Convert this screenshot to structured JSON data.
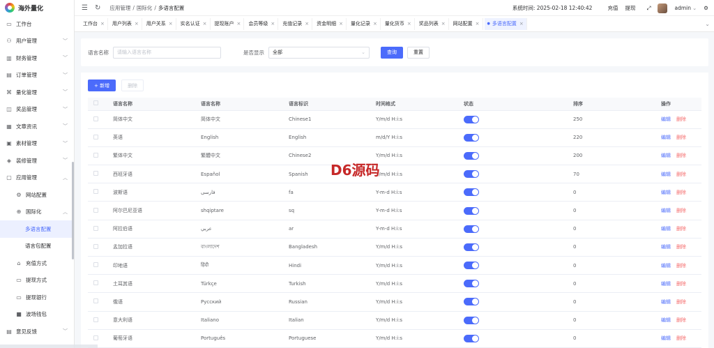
{
  "app": {
    "title": "海外量化"
  },
  "sidebar": {
    "items": [
      {
        "label": "工作台",
        "icon": "monitor-icon",
        "glyph": "▭",
        "chevron": false,
        "level": 0
      },
      {
        "label": "用户管理",
        "icon": "user-icon",
        "glyph": "⚇",
        "chevron": true,
        "level": 0
      },
      {
        "label": "财务管理",
        "icon": "finance-icon",
        "glyph": "▥",
        "chevron": true,
        "level": 0
      },
      {
        "label": "订单管理",
        "icon": "order-icon",
        "glyph": "▤",
        "chevron": true,
        "level": 0
      },
      {
        "label": "量化管理",
        "icon": "quant-icon",
        "glyph": "⌘",
        "chevron": true,
        "level": 0
      },
      {
        "label": "奖品管理",
        "icon": "gift-icon",
        "glyph": "◫",
        "chevron": true,
        "level": 0
      },
      {
        "label": "文章资讯",
        "icon": "article-icon",
        "glyph": "▦",
        "chevron": true,
        "level": 0
      },
      {
        "label": "素材管理",
        "icon": "image-icon",
        "glyph": "▣",
        "chevron": true,
        "level": 0
      },
      {
        "label": "装修管理",
        "icon": "decorate-icon",
        "glyph": "◈",
        "chevron": true,
        "level": 0
      },
      {
        "label": "应用管理",
        "icon": "app-icon",
        "glyph": "▢",
        "chevron": true,
        "level": 0
      },
      {
        "label": "网站配置",
        "icon": "gear-icon",
        "glyph": "⚙",
        "chevron": false,
        "level": 1
      },
      {
        "label": "国际化",
        "icon": "globe-icon",
        "glyph": "⊕",
        "chevron": true,
        "level": 1
      },
      {
        "label": "多语言配置",
        "icon": "",
        "glyph": "",
        "chevron": false,
        "level": 2,
        "active": true
      },
      {
        "label": "语言包配置",
        "icon": "",
        "glyph": "",
        "chevron": false,
        "level": 2
      },
      {
        "label": "充值方式",
        "icon": "recharge-icon",
        "glyph": "⌂",
        "chevron": false,
        "level": 1
      },
      {
        "label": "提现方式",
        "icon": "folder-icon",
        "glyph": "▭",
        "chevron": false,
        "level": 1
      },
      {
        "label": "提现银行",
        "icon": "bank-icon",
        "glyph": "▭",
        "chevron": false,
        "level": 1
      },
      {
        "label": "波场钱包",
        "icon": "wallet-icon",
        "glyph": "■",
        "chevron": false,
        "level": 1
      },
      {
        "label": "意见反馈",
        "icon": "feedback-icon",
        "glyph": "▤",
        "chevron": true,
        "level": 0
      }
    ]
  },
  "header": {
    "breadcrumb": [
      "应用管理",
      "国际化",
      "多语言配置"
    ],
    "system_time_label": "系统时间: 2025-02-18 12:40:42",
    "recharge": "充值",
    "withdraw": "提现",
    "user": "admin"
  },
  "tabs": [
    {
      "label": "工作台",
      "active": false
    },
    {
      "label": "用户列表",
      "active": false
    },
    {
      "label": "用户关系",
      "active": false
    },
    {
      "label": "实名认证",
      "active": false
    },
    {
      "label": "提现账户",
      "active": false
    },
    {
      "label": "会员等级",
      "active": false
    },
    {
      "label": "充值记录",
      "active": false
    },
    {
      "label": "资金明细",
      "active": false
    },
    {
      "label": "量化记录",
      "active": false
    },
    {
      "label": "量化货币",
      "active": false
    },
    {
      "label": "奖品列表",
      "active": false
    },
    {
      "label": "网站配置",
      "active": false
    },
    {
      "label": "多语言配置",
      "active": true
    }
  ],
  "filter": {
    "name_label": "语言名称",
    "name_placeholder": "请输入语言名称",
    "show_label": "是否显示",
    "show_value": "全部",
    "search": "查询",
    "reset": "重置"
  },
  "toolbar": {
    "add": "+ 新增",
    "delete": "删除"
  },
  "table": {
    "headers": [
      "语言名称",
      "语言名称",
      "语言标识",
      "时间格式",
      "状态",
      "排序",
      "操作"
    ],
    "edit": "编辑",
    "delete": "删除",
    "rows": [
      [
        "简体中文",
        "简体中文",
        "Chinese1",
        "Y/m/d H:i:s",
        "250"
      ],
      [
        "英语",
        "English",
        "English",
        "m/d/Y H:i:s",
        "220"
      ],
      [
        "繁体中文",
        "繁體中文",
        "Chinese2",
        "Y/m/d H:i:s",
        "200"
      ],
      [
        "西班牙语",
        "Español",
        "Spanish",
        "Y/m/d H:i:s",
        "70"
      ],
      [
        "波斯语",
        "فارسی",
        "fa",
        "Y-m-d H:i:s",
        "0"
      ],
      [
        "阿尔巴尼亚语",
        "shqiptare",
        "sq",
        "Y-m-d H:i:s",
        "0"
      ],
      [
        "阿拉伯语",
        "عربي",
        "ar",
        "Y-m-d H:i:s",
        "0"
      ],
      [
        "孟加拉语",
        "বাংলাদেশ",
        "Bangladesh",
        "Y/m/d H:i:s",
        "0"
      ],
      [
        "印地语",
        "हिंदी",
        "Hindi",
        "Y/m/d H:i:s",
        "0"
      ],
      [
        "土耳其语",
        "Türkçe",
        "Turkish",
        "Y/m/d H:i:s",
        "0"
      ],
      [
        "俄语",
        "Русский",
        "Russian",
        "Y/m/d H:i:s",
        "0"
      ],
      [
        "意大利语",
        "Italiano",
        "Italian",
        "Y/m/d H:i:s",
        "0"
      ],
      [
        "葡萄牙语",
        "Português",
        "Portuguese",
        "Y/m/d H:i:s",
        "0"
      ]
    ]
  },
  "watermark": "D6源码",
  "colors": {
    "accent": "#4b6bfb",
    "danger": "#f56c6c",
    "watermark": "#c62828"
  }
}
